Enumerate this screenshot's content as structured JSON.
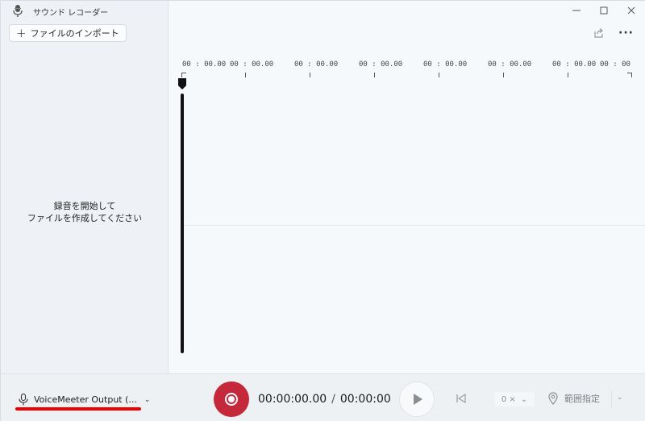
{
  "app": {
    "title": "サウンド レコーダー"
  },
  "sidebar": {
    "import_label": "ファイルのインポート",
    "empty_line1": "録音を開始して",
    "empty_line2": "ファイルを作成してください"
  },
  "ruler": {
    "labels": [
      "00 : 00.00",
      "00 : 00.00",
      "00 : 00.00",
      "00 : 00.00",
      "00 : 00.00",
      "00 : 00.00",
      "00 : 00.00",
      "00 : 00"
    ]
  },
  "controls": {
    "device_label": "VoiceMeeter Output (...",
    "current_time": "00:00:00.00",
    "time_separator": "/",
    "total_time": "00:00:00",
    "speed_label": "0 ×",
    "range_label": "範囲指定"
  },
  "icons": {
    "app": "microphone-app-icon",
    "import": "plus-icon",
    "share": "share-icon",
    "more": "more-icon",
    "mic": "microphone-icon",
    "record": "record-icon",
    "play": "play-icon",
    "skip_back": "skip-to-start-icon",
    "pin": "location-pin-icon"
  },
  "colors": {
    "record": "#c4283a",
    "annotation_underline": "#ee0000"
  }
}
